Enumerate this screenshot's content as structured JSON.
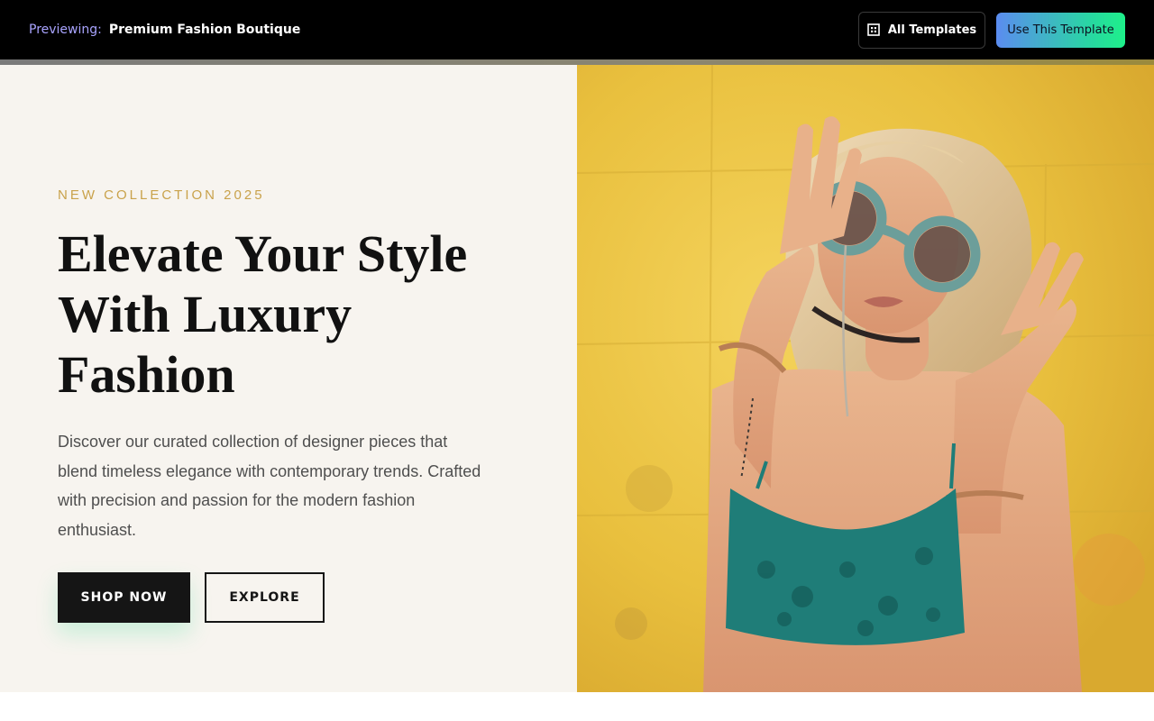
{
  "preview_bar": {
    "label": "Previewing:",
    "template_name": "Premium Fashion Boutique",
    "all_templates_label": "All Templates",
    "use_template_label": "Use This Template",
    "icons": {
      "all_templates": "grid-icon"
    }
  },
  "hero": {
    "eyebrow": "NEW COLLECTION 2025",
    "headline": "Elevate Your Style With Luxury Fashion",
    "description": "Discover our curated collection of designer pieces that blend timeless elegance with contemporary trends. Crafted with precision and passion for the modern fashion enthusiast.",
    "primary_cta": "SHOP NOW",
    "secondary_cta": "EXPLORE",
    "image_subject": "woman-with-round-sunglasses-on-yellow-wall"
  },
  "colors": {
    "accent_gold": "#c9a24b",
    "dark": "#151515",
    "hero_background": "#f7f4ef",
    "image_background_yellow": "#e8c13e",
    "cta_gradient_start": "#5b8cf0",
    "cta_gradient_end": "#1ef08a"
  }
}
